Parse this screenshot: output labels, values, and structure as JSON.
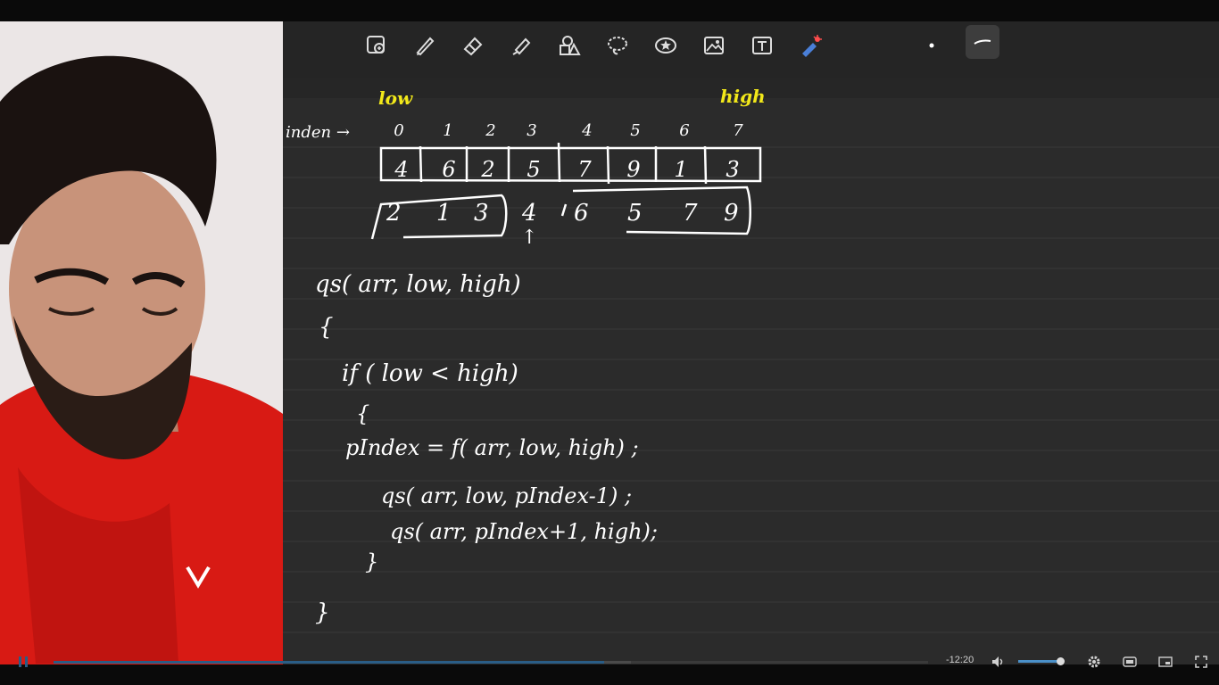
{
  "board": {
    "labels": {
      "low": "low",
      "high": "high",
      "index": "inden →"
    },
    "indices": [
      "0",
      "1",
      "2",
      "3",
      "4",
      "5",
      "6",
      "7"
    ],
    "array": [
      "4",
      "6",
      "2",
      "5",
      "7",
      "9",
      "1",
      "3"
    ],
    "partition_left": [
      "2",
      "1",
      "3"
    ],
    "pivot": "4",
    "partition_right": [
      "6",
      "5",
      "7",
      "9"
    ],
    "pivot_arrow": "↑",
    "code": [
      "qs( arr, low, high)",
      "{",
      "if ( low < high)",
      "{",
      "pIndex = f( arr, low, high) ;",
      "qs( arr, low, pIndex-1) ;",
      "qs( arr, pIndex+1, high);",
      "}",
      "}"
    ]
  },
  "toolbar": {
    "tools": [
      "zoom-icon",
      "pen-icon",
      "eraser-icon",
      "highlighter-icon",
      "shapes-icon",
      "lasso-icon",
      "sticker-icon",
      "image-icon",
      "text-icon",
      "laser-pointer-icon"
    ],
    "selected_stroke": "stroke-width-icon"
  },
  "player": {
    "time_remaining": "-12:20",
    "progress_played": 0.63,
    "progress_buffered": 0.66,
    "volume": 0.95
  },
  "colors": {
    "board": "#2b2b2b",
    "highlight": "#f2e81a",
    "ink": "#ffffff",
    "accent": "#2a5d86"
  }
}
